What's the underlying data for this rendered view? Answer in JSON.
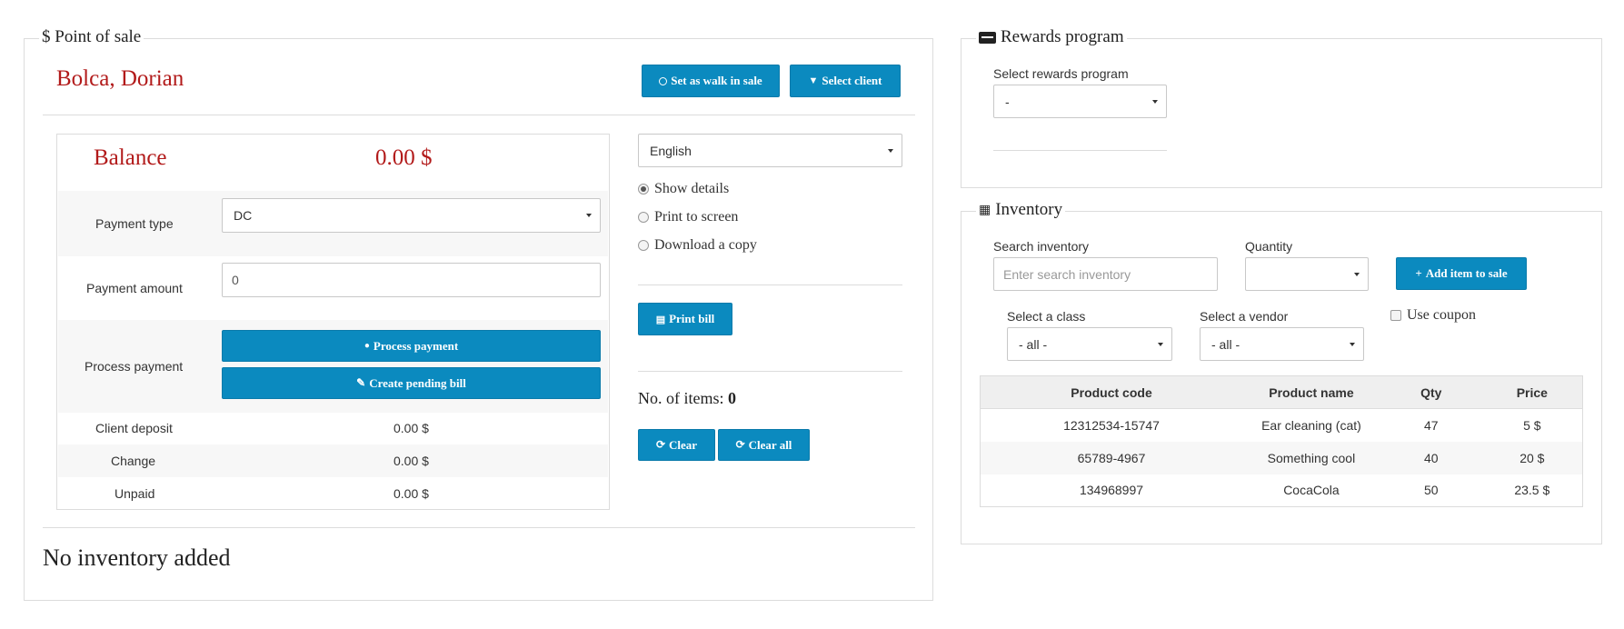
{
  "pos": {
    "legend": "$ Point of sale",
    "client_name": "Bolca, Dorian",
    "walk_in_label": "Set as walk in sale",
    "select_client_label": "Select client",
    "balance_label": "Balance",
    "balance_value": "0.00 $",
    "payment_type_label": "Payment type",
    "payment_type_value": "DC",
    "payment_amount_label": "Payment amount",
    "payment_amount_value": "0",
    "process_payment_label": "Process payment",
    "process_payment_button": "Process payment",
    "create_pending_bill_button": "Create pending bill",
    "client_deposit_label": "Client deposit",
    "client_deposit_value": "0.00 $",
    "change_label": "Change",
    "change_value": "0.00 $",
    "unpaid_label": "Unpaid",
    "unpaid_value": "0.00 $",
    "language_value": "English",
    "options": [
      "Show details",
      "Print to screen",
      "Download a copy"
    ],
    "selected_option": "Show details",
    "print_bill_label": "Print bill",
    "items_label": "No. of items:",
    "items_count": "0",
    "clear_label": "Clear",
    "clear_all_label": "Clear all",
    "no_inventory_text": "No inventory added"
  },
  "rewards": {
    "legend": "Rewards program",
    "select_label": "Select rewards program",
    "select_value": "-"
  },
  "inventory": {
    "legend": "Inventory",
    "search_label": "Search inventory",
    "search_placeholder": "Enter search inventory",
    "quantity_label": "Quantity",
    "quantity_value": "",
    "add_item_label": "Add item to sale",
    "class_label": "Select a class",
    "class_value": "- all -",
    "vendor_label": "Select a vendor",
    "vendor_value": "- all -",
    "coupon_label": "Use coupon",
    "columns": [
      "Product code",
      "Product name",
      "Qty",
      "Price"
    ],
    "rows": [
      [
        "12312534-15747",
        "Ear cleaning (cat)",
        "47",
        "5 $"
      ],
      [
        "65789-4967",
        "Something cool",
        "40",
        "20 $"
      ],
      [
        "134968997",
        "CocaCola",
        "50",
        "23.5 $"
      ]
    ]
  },
  "colors": {
    "accent": "#0b8abf",
    "client_name": "#b21a1a",
    "balance": "#b21a1a"
  }
}
